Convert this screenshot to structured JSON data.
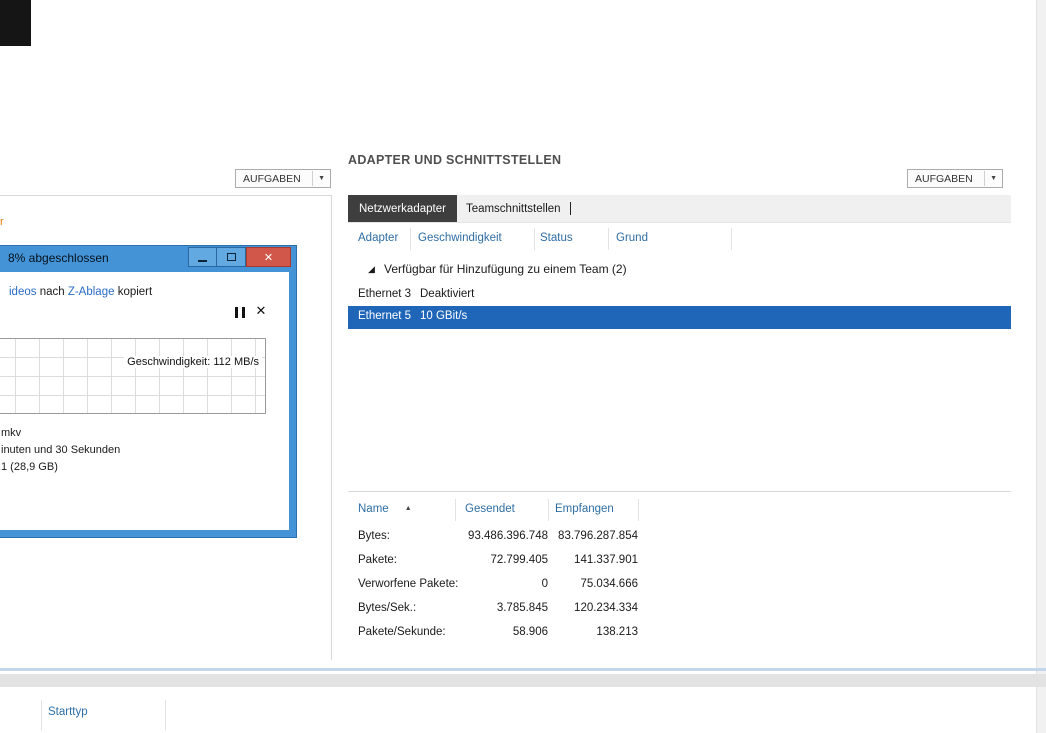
{
  "icons": {
    "chevron_down": "▼",
    "close": "✕",
    "cancel": "✕",
    "group_expanded": "◢",
    "sort_ascending": "▲"
  },
  "left_panel": {
    "tasks_button_label": "AUFGABEN",
    "text_fragment": "r"
  },
  "copy_dialog": {
    "title": "8% abgeschlossen",
    "status": {
      "source_link": "ideos",
      "middle": " nach ",
      "destination_link": "Z-Ablage",
      "suffix": " kopiert"
    },
    "speed_label": "Geschwindigkeit: 112 MB/s",
    "file_fragment": "mkv",
    "time_fragment": "inuten und 30 Sekunden",
    "items_fragment": "1 (28,9 GB)"
  },
  "adapters_panel": {
    "title": "ADAPTER UND SCHNITTSTELLEN",
    "tasks_button_label": "AUFGABEN",
    "tabs": {
      "network_adapters": "Netzwerkadapter",
      "team_interfaces": "Teamschnittstellen"
    },
    "adapter_table": {
      "headers": {
        "adapter": "Adapter",
        "speed": "Geschwindigkeit",
        "status": "Status",
        "reason": "Grund"
      },
      "group_label": "Verfügbar für Hinzufügung zu einem Team (2)",
      "rows": [
        {
          "adapter": "Ethernet 3",
          "speed": "Deaktiviert"
        },
        {
          "adapter": "Ethernet 5",
          "speed": "10 GBit/s"
        }
      ]
    },
    "statistics": {
      "headers": {
        "name": "Name",
        "sent": "Gesendet",
        "received": "Empfangen"
      },
      "rows": [
        {
          "name": "Bytes:",
          "sent": "93.486.396.748",
          "received": "83.796.287.854"
        },
        {
          "name": "Pakete:",
          "sent": "72.799.405",
          "received": "141.337.901"
        },
        {
          "name": "Verworfene Pakete:",
          "sent": "0",
          "received": "75.034.666"
        },
        {
          "name": "Bytes/Sek.:",
          "sent": "3.785.845",
          "received": "120.234.334"
        },
        {
          "name": "Pakete/Sekunde:",
          "sent": "58.906",
          "received": "138.213"
        }
      ]
    }
  },
  "bottom_panel": {
    "column_header": "Starttyp"
  }
}
